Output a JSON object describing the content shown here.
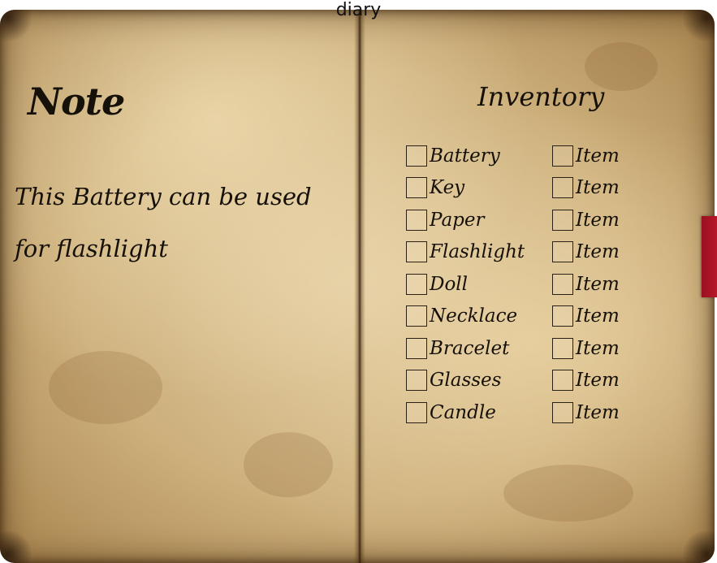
{
  "title": "diary",
  "note": {
    "heading": "Note",
    "body": "This Battery can be used for flashlight"
  },
  "inventory": {
    "heading": "Inventory",
    "left_items": [
      {
        "label": "Battery",
        "checked": false
      },
      {
        "label": "Key",
        "checked": false
      },
      {
        "label": "Paper",
        "checked": false
      },
      {
        "label": "Flashlight",
        "checked": false
      },
      {
        "label": "Doll",
        "checked": false
      },
      {
        "label": "Necklace",
        "checked": false
      },
      {
        "label": "Bracelet",
        "checked": false
      },
      {
        "label": "Glasses",
        "checked": false
      },
      {
        "label": "Candle",
        "checked": false
      }
    ],
    "right_items": [
      {
        "label": "Item",
        "checked": false
      },
      {
        "label": "Item",
        "checked": false
      },
      {
        "label": "Item",
        "checked": false
      },
      {
        "label": "Item",
        "checked": false
      },
      {
        "label": "Item",
        "checked": false
      },
      {
        "label": "Item",
        "checked": false
      },
      {
        "label": "Item",
        "checked": false
      },
      {
        "label": "Item",
        "checked": false
      },
      {
        "label": "Item",
        "checked": false
      }
    ]
  },
  "colors": {
    "paper": "#cdb07c",
    "ink": "#151008",
    "bookmark": "#b8182a"
  }
}
